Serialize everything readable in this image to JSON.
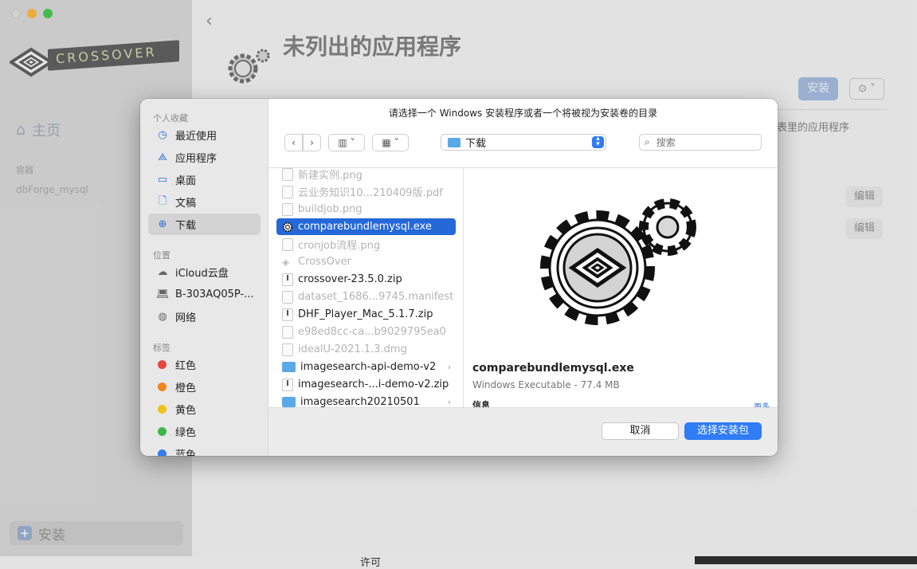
{
  "app": {
    "logo_text": "CROSSOVER",
    "nav_home": "主页",
    "containers_label": "容器",
    "container_item": "dbForge_mysql",
    "install_bottom": "安装",
    "main_title": "未列出的应用程序",
    "install_top": "安装",
    "more_button": "⊙ ˅",
    "apps_text": "表里的应用程序",
    "edit_1": "编辑",
    "edit_2": "编辑",
    "license": "许可"
  },
  "dialog": {
    "prompt": "请选择一个 Windows 安装程序或者一个将被视为安装卷的目录",
    "sidebar": {
      "favorites_label": "个人收藏",
      "favorites": [
        {
          "label": "最近使用",
          "icon": "clock-icon"
        },
        {
          "label": "应用程序",
          "icon": "apps-icon"
        },
        {
          "label": "桌面",
          "icon": "desktop-icon"
        },
        {
          "label": "文稿",
          "icon": "document-icon"
        },
        {
          "label": "下载",
          "icon": "download-icon",
          "active": true
        }
      ],
      "locations_label": "位置",
      "locations": [
        {
          "label": "iCloud云盘",
          "icon": "cloud-icon"
        },
        {
          "label": "B-303AQ05P-...",
          "icon": "laptop-icon"
        },
        {
          "label": "网络",
          "icon": "globe-icon"
        }
      ],
      "tags_label": "标签",
      "tags": [
        {
          "label": "红色",
          "color": "#e8473e"
        },
        {
          "label": "橙色",
          "color": "#f0861f"
        },
        {
          "label": "黄色",
          "color": "#f2c21b"
        },
        {
          "label": "绿色",
          "color": "#3ab84a"
        },
        {
          "label": "蓝色",
          "color": "#2f7cf6"
        }
      ]
    },
    "toolbar": {
      "back": "‹",
      "forward": "›",
      "view_columns": "▥ ˅",
      "view_grid": "▦ ˅",
      "location": "下载",
      "search_placeholder": "搜索"
    },
    "files": [
      {
        "name": "新建实例.png",
        "type": "image",
        "dim": true
      },
      {
        "name": "云业务知识10...210409版.pdf",
        "type": "doc",
        "dim": true
      },
      {
        "name": "buildjob.png",
        "type": "image",
        "dim": true
      },
      {
        "name": "comparebundlemysql.exe",
        "type": "exe",
        "selected": true
      },
      {
        "name": "cronjob流程.png",
        "type": "image",
        "dim": true
      },
      {
        "name": "CrossOver",
        "type": "app",
        "dim": true
      },
      {
        "name": "crossover-23.5.0.zip",
        "type": "zip"
      },
      {
        "name": "dataset_1686...9745.manifest",
        "type": "doc",
        "dim": true
      },
      {
        "name": "DHF_Player_Mac_5.1.7.zip",
        "type": "zip"
      },
      {
        "name": "e98ed8cc-ca...b9029795ea0",
        "type": "doc",
        "dim": true
      },
      {
        "name": "idealU-2021.1.3.dmg",
        "type": "doc",
        "dim": true
      },
      {
        "name": "imagesearch-api-demo-v2",
        "type": "folder",
        "chevron": true
      },
      {
        "name": "imagesearch-...i-demo-v2.zip",
        "type": "zip"
      },
      {
        "name": "imagesearch20210501",
        "type": "folder",
        "chevron": true
      }
    ],
    "preview": {
      "name": "comparebundlemysql.exe",
      "kind": "Windows Executable - 77.4 MB",
      "info_label": "信息",
      "more_label": "更多"
    },
    "buttons": {
      "cancel": "取消",
      "choose": "选择安装包"
    }
  }
}
